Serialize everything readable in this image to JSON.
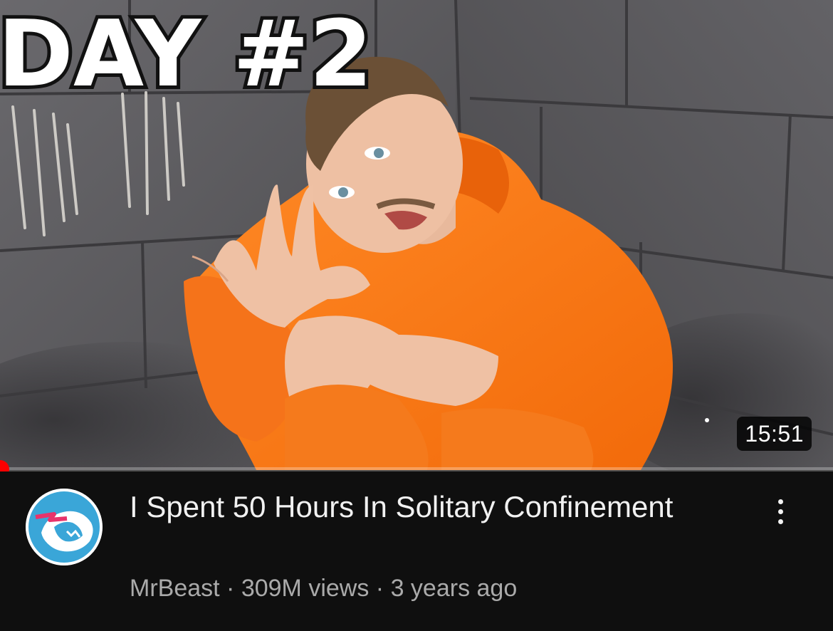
{
  "video": {
    "thumbnail_text": "DAY #2",
    "duration": "15:51",
    "title": "I Spent 50 Hours In Solitary Confinement",
    "channel": "MrBeast",
    "separator": "·",
    "views": "309M views",
    "age": "3 years ago",
    "progress_fraction": 0.01
  },
  "icons": {
    "more": "more-vertical-icon",
    "avatar": "mrbeast-logo"
  },
  "colors": {
    "background": "#0f0f0f",
    "progress": "#ff0000",
    "title": "#f1f1f1",
    "meta": "#aaaaaa",
    "jumpsuit": "#ff7a1a",
    "avatar_blue": "#3aa6d8"
  }
}
